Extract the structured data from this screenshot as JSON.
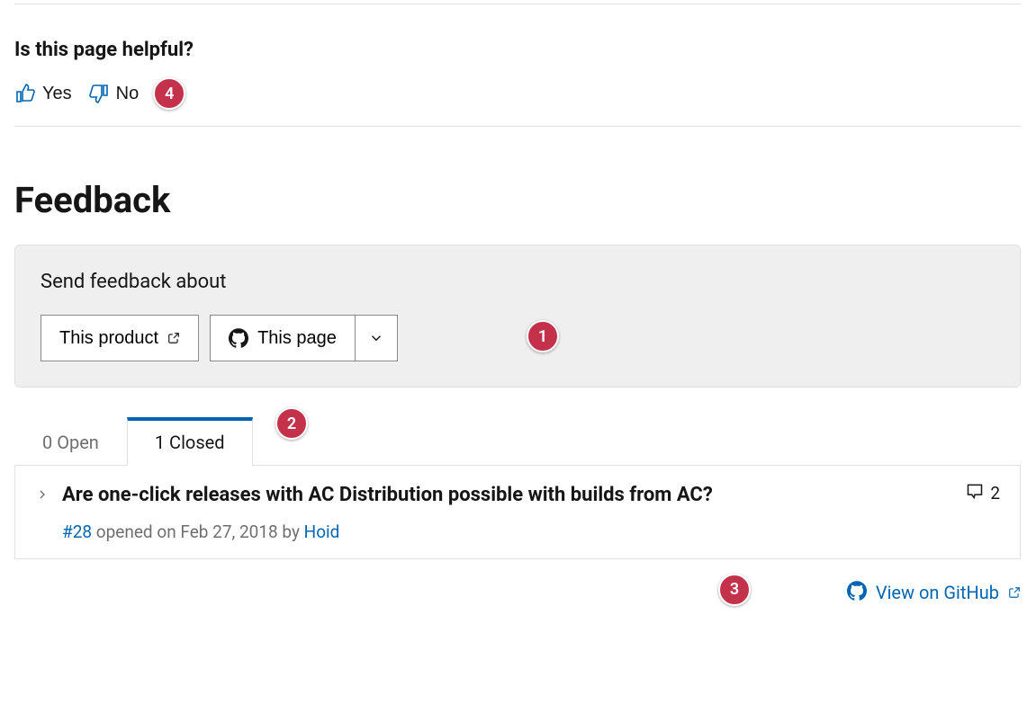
{
  "helpful": {
    "title": "Is this page helpful?",
    "yes_label": "Yes",
    "no_label": "No"
  },
  "feedback": {
    "heading": "Feedback",
    "send_label": "Send feedback about",
    "product_btn": "This product",
    "page_btn": "This page"
  },
  "tabs": {
    "open_label": "0 Open",
    "closed_label": "1 Closed"
  },
  "issue": {
    "title": "Are one-click releases with AC Distribution possible with builds from AC?",
    "number": "#28",
    "opened_text": " opened on Feb 27, 2018 by ",
    "author": "Hoid",
    "comment_count": "2"
  },
  "view_link": "View on GitHub",
  "badges": {
    "b1": "1",
    "b2": "2",
    "b3": "3",
    "b4": "4"
  }
}
